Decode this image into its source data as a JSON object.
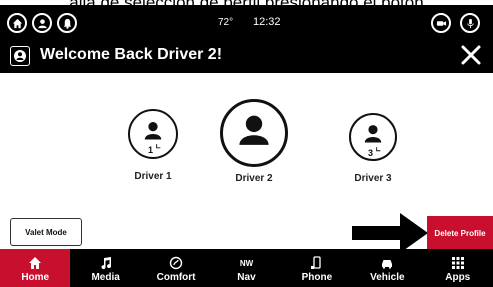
{
  "caption": "alla de selección de perfil presionando el botón",
  "statusbar": {
    "temperature": "72°",
    "time": "12:32",
    "left_icons": [
      "home-icon",
      "profile-icon",
      "bell-icon"
    ],
    "right_icons": [
      "camera-icon",
      "mic-icon"
    ]
  },
  "titlebar": {
    "title": "Welcome Back Driver 2!",
    "avatar_icon": "profile-icon",
    "close_icon": "close-icon"
  },
  "drivers": [
    {
      "label": "Driver 1",
      "seat": "1",
      "selected": false
    },
    {
      "label": "Driver 2",
      "seat": "",
      "selected": true
    },
    {
      "label": "Driver 3",
      "seat": "3",
      "selected": false
    }
  ],
  "buttons": {
    "valet": "Valet Mode",
    "delete": "Delete Profile"
  },
  "nav": [
    {
      "label": "Home",
      "icon": "home-icon",
      "active": true
    },
    {
      "label": "Media",
      "icon": "music-note-icon",
      "active": false
    },
    {
      "label": "Comfort",
      "icon": "comfort-icon",
      "active": false
    },
    {
      "label": "Nav",
      "icon": "compass-icon",
      "icon_text": "NW",
      "active": false
    },
    {
      "label": "Phone",
      "icon": "phone-icon",
      "active": false
    },
    {
      "label": "Vehicle",
      "icon": "car-icon",
      "active": false
    },
    {
      "label": "Apps",
      "icon": "grid-icon",
      "active": false
    }
  ],
  "colors": {
    "accent": "#c8102e",
    "bar": "#000000",
    "background": "#ffffff"
  }
}
